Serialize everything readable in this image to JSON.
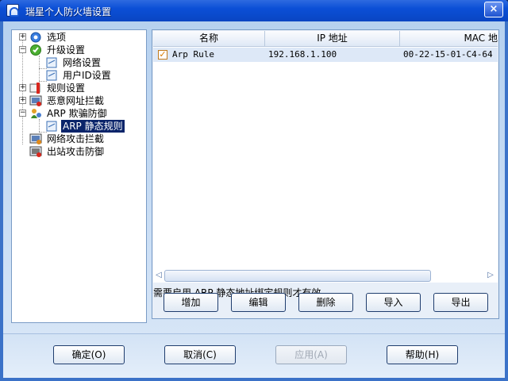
{
  "window": {
    "title": "瑞星个人防火墙设置",
    "close_label": "×"
  },
  "tree": {
    "items": [
      {
        "label": "选项",
        "expander": "+"
      },
      {
        "label": "升级设置",
        "expander": "−"
      },
      {
        "label": "网络设置"
      },
      {
        "label": "用户ID设置"
      },
      {
        "label": "规则设置",
        "expander": "+"
      },
      {
        "label": "恶意网址拦截",
        "expander": "+"
      },
      {
        "label": "ARP 欺骗防御",
        "expander": "−"
      },
      {
        "label": "ARP 静态规则",
        "selected": true
      },
      {
        "label": "网络攻击拦截"
      },
      {
        "label": "出站攻击防御"
      }
    ]
  },
  "list": {
    "columns": [
      "名称",
      "IP 地址",
      "MAC 地"
    ],
    "rows": [
      {
        "checked": true,
        "check_glyph": "✓",
        "name": "Arp Rule",
        "ip": "192.168.1.100",
        "mac": "00-22-15-01-C4-64"
      }
    ],
    "scroll_left": "◁",
    "scroll_right": "▷"
  },
  "hint": "需要启用 ARP 静态地址绑定规则才有效",
  "actions": {
    "add": "增加",
    "edit": "编辑",
    "delete": "删除",
    "import": "导入",
    "export": "导出"
  },
  "footer": {
    "ok": "确定(O)",
    "cancel": "取消(C)",
    "apply": "应用(A)",
    "help": "帮助(H)"
  },
  "colors": {
    "title_bar": "#0b4fd6",
    "selection": "#0a246a",
    "row_highlight": "#dde8f7"
  }
}
